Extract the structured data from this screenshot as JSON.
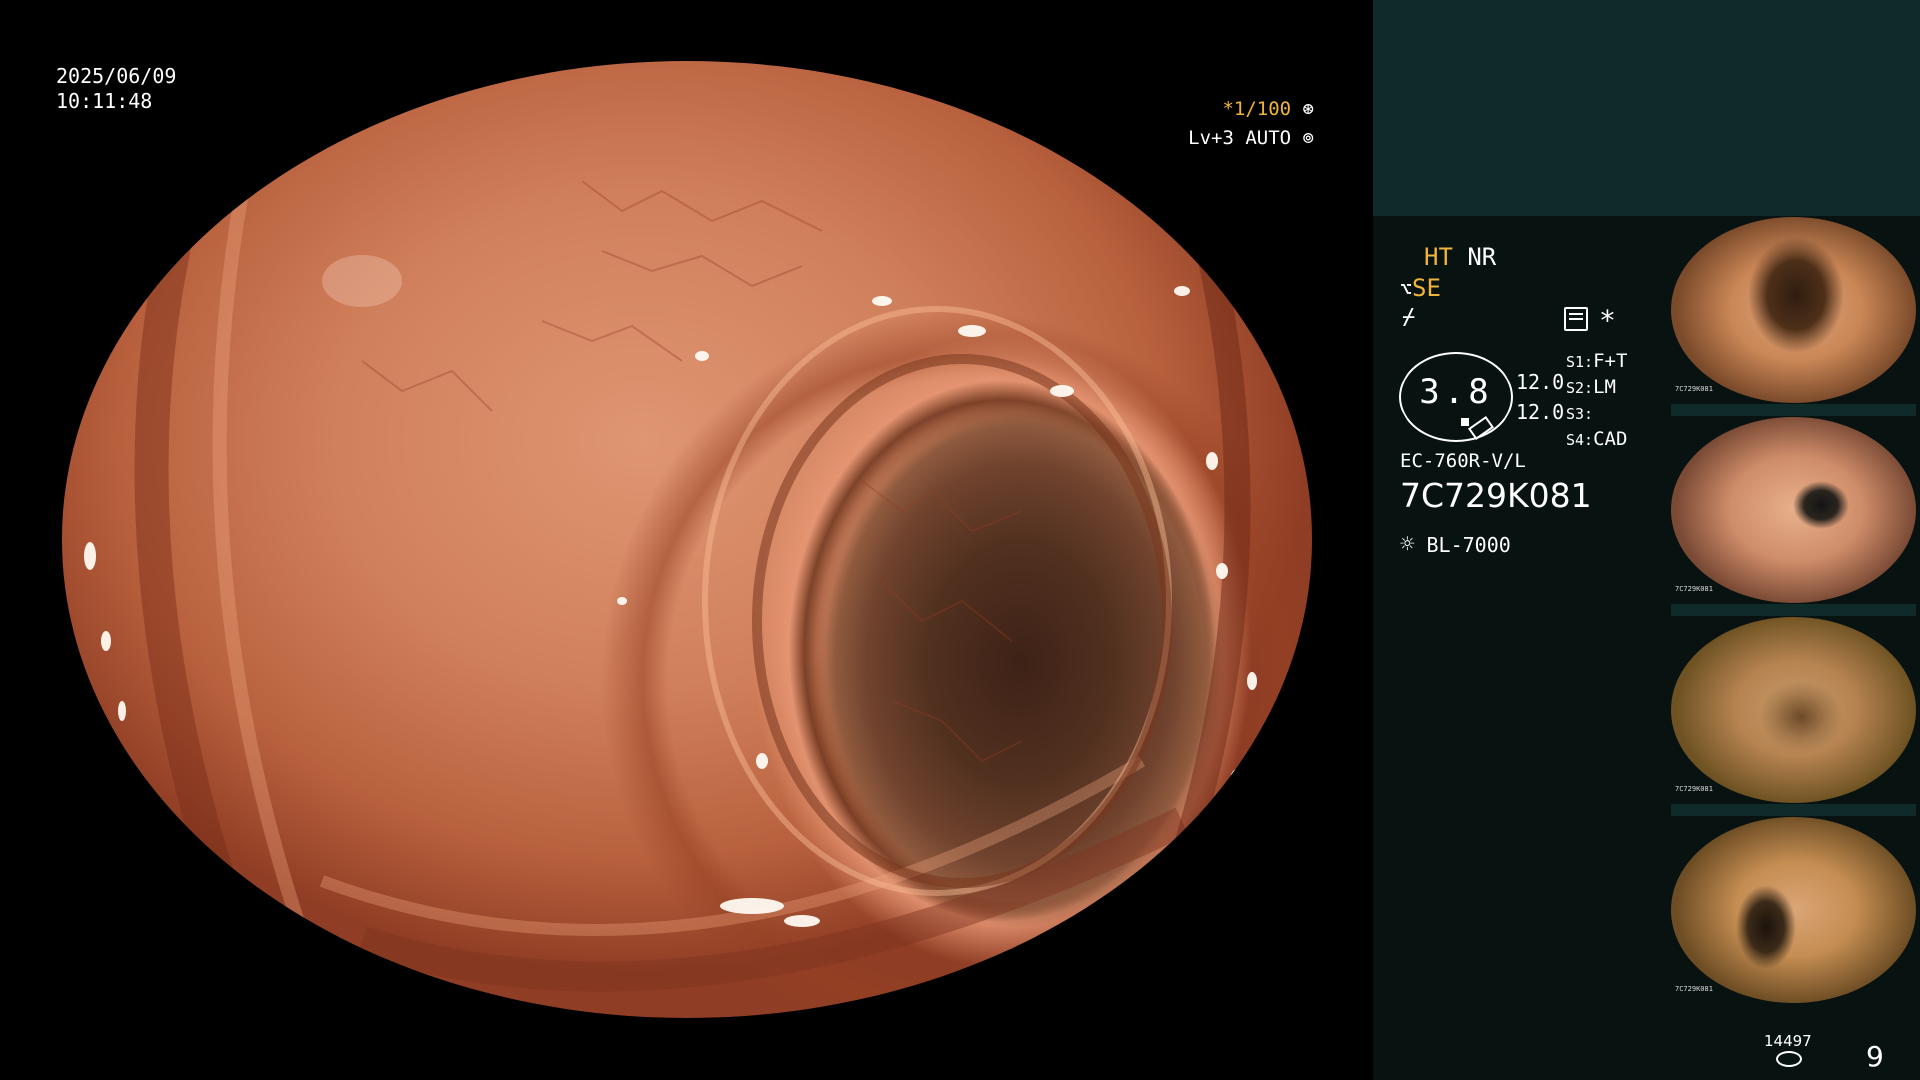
{
  "overlay": {
    "date": "2025/06/09",
    "time": "10:11:48",
    "shutter": "*1/100",
    "shutter_icon": "aperture-icon",
    "level": "Lv+3 AUTO",
    "level_icon": "iris-icon"
  },
  "panel": {
    "modes": {
      "ht": "HT",
      "nr": "NR",
      "se": "SE"
    },
    "icons": [
      "scope-tip-icon",
      "sharpness-icon",
      "settings-list-icon"
    ],
    "asterisk": "*",
    "gauge_value": "3.8",
    "gauge_sub1": "12.0",
    "gauge_sub2": "12.0",
    "switches": [
      {
        "key": "S1:",
        "value": "F+T"
      },
      {
        "key": "S2:",
        "value": "LM"
      },
      {
        "key": "S3:",
        "value": ""
      },
      {
        "key": "S4:",
        "value": "CAD"
      }
    ],
    "scope_model": "EC-760R-V/L",
    "serial": "7C729K081",
    "light_source": "BL-7000",
    "light_icon": "sun-icon",
    "thumb_code": "7C729K081",
    "thumb_source": "BL-7000"
  },
  "footer": {
    "storage_count": "14497",
    "storage_icon": "disk-stack-icon",
    "image_count": "9"
  },
  "colors": {
    "accent_orange": "#f0b43a",
    "panel_teal": "#0e2a29",
    "panel_dark": "#071211"
  }
}
